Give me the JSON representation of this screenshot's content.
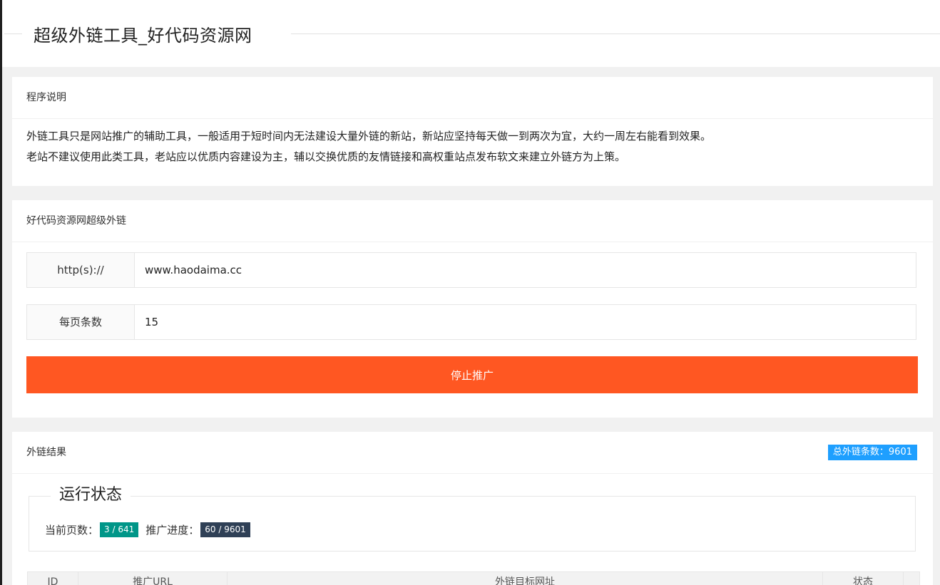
{
  "page": {
    "title": "超级外链工具_好代码资源网"
  },
  "intro": {
    "heading": "程序说明",
    "line1": "外链工具只是网站推广的辅助工具，一般适用于短时间内无法建设大量外链的新站，新站应坚持每天做一到两次为宜，大约一周左右能看到效果。",
    "line2": "老站不建议使用此类工具，老站应以优质内容建设为主，辅以交换优质的友情链接和高权重站点发布软文来建立外链方为上策。"
  },
  "tool": {
    "heading": "好代码资源网超级外链",
    "url_label": "http(s)://",
    "url_value": "www.haodaima.cc",
    "per_page_label": "每页条数",
    "per_page_value": "15",
    "stop_button": "停止推广"
  },
  "results": {
    "heading": "外链结果",
    "total_badge": "总外链条数：9601",
    "status_legend": "运行状态",
    "current_page_label": "当前页数：",
    "current_page_value": "3 / 641",
    "progress_label": "推广进度：",
    "progress_value": "60 / 9601",
    "table_headers": [
      "ID",
      "推广URL",
      "外链目标网址",
      "状态",
      ""
    ]
  },
  "colors": {
    "accent": "#ff5722",
    "badge_blue": "#1e9fff",
    "badge_green": "#009688",
    "badge_dark": "#2f4056"
  }
}
